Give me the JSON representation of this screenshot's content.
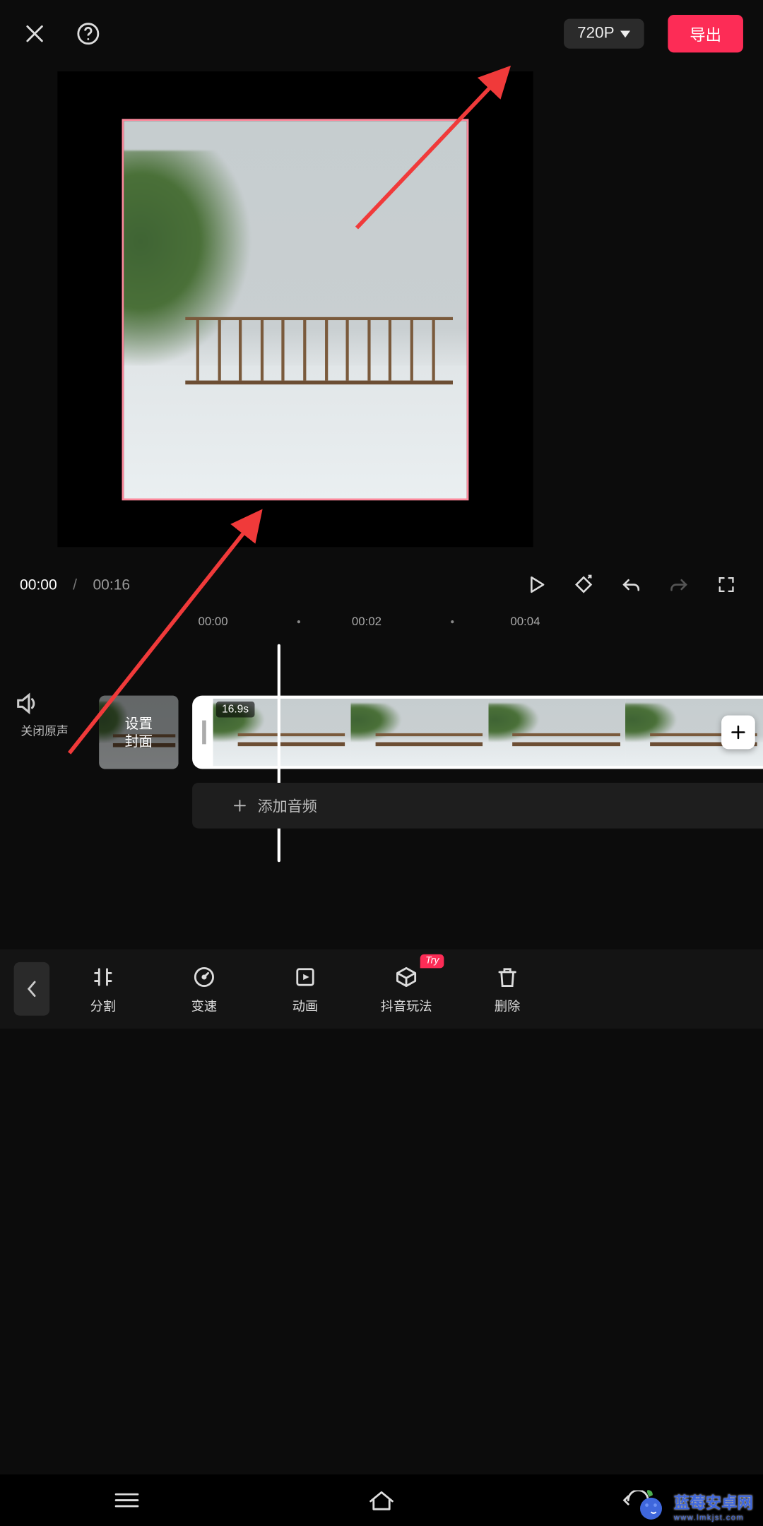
{
  "header": {
    "resolution": "720P",
    "export_label": "导出"
  },
  "player": {
    "current_time": "00:00",
    "separator": "/",
    "total_time": "00:16"
  },
  "ruler": {
    "ticks": [
      "00:00",
      "00:02",
      "00:04"
    ]
  },
  "mute": {
    "label": "关闭原声"
  },
  "cover_tile": {
    "label": "设置\n封面"
  },
  "clip": {
    "duration_badge": "16.9s"
  },
  "audio_row": {
    "label": "添加音频"
  },
  "tools": {
    "try_badge": "Try",
    "items": [
      {
        "label": "分割"
      },
      {
        "label": "变速"
      },
      {
        "label": "动画"
      },
      {
        "label": "抖音玩法"
      },
      {
        "label": "删除"
      }
    ]
  },
  "watermark": {
    "title": "蓝莓安卓网",
    "sub": "www.lmkjst.com"
  }
}
